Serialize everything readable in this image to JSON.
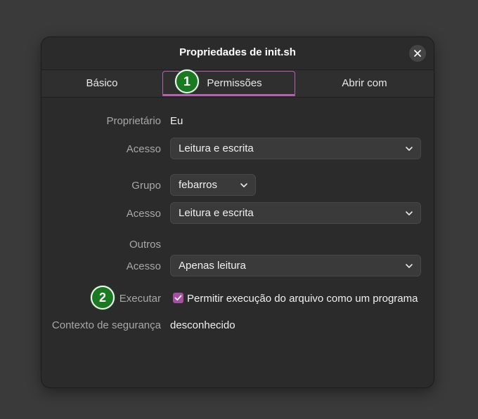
{
  "window": {
    "title": "Propriedades de init.sh"
  },
  "tabs": [
    {
      "label": "Básico"
    },
    {
      "label": "Permissões"
    },
    {
      "label": "Abrir com"
    }
  ],
  "permissions": {
    "owner_label": "Proprietário",
    "owner_value": "Eu",
    "owner_access_label": "Acesso",
    "owner_access_value": "Leitura e escrita",
    "group_label": "Grupo",
    "group_value": "febarros",
    "group_access_label": "Acesso",
    "group_access_value": "Leitura e escrita",
    "others_label": "Outros",
    "others_access_label": "Acesso",
    "others_access_value": "Apenas leitura",
    "execute_label": "Executar",
    "execute_checkbox_label": "Permitir execução do arquivo como um programa",
    "execute_checked": true,
    "security_label": "Contexto de segurança",
    "security_value": "desconhecido"
  },
  "annotations": [
    {
      "number": "1"
    },
    {
      "number": "2"
    }
  ],
  "colors": {
    "accent": "#b660b0",
    "checkbox": "#a64ea2",
    "badge": "#1a7a22"
  },
  "icons": {
    "close": "close-icon",
    "dropdown": "chevron-down-icon",
    "check": "check-icon"
  }
}
